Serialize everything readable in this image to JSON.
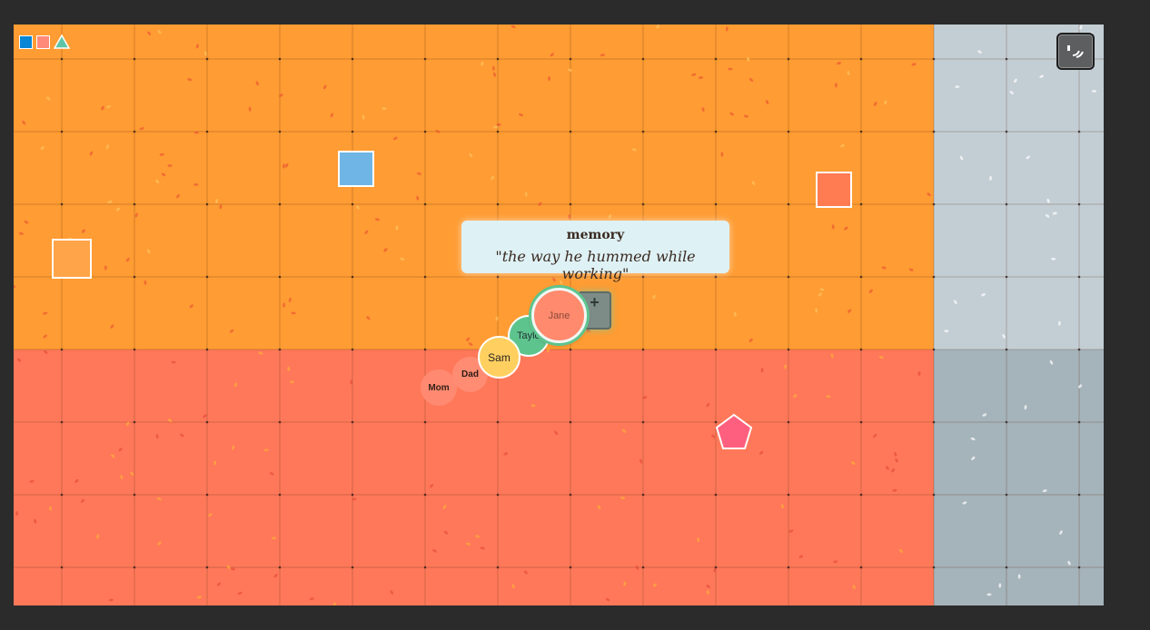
{
  "board": {
    "zones": [
      {
        "name": "orange-zone",
        "color": "#ff9c33"
      },
      {
        "name": "red-zone",
        "color": "#ff7859"
      },
      {
        "name": "gray-zone-top",
        "color": "#c3ced4"
      },
      {
        "name": "gray-zone-bottom",
        "color": "#a5b3ba"
      }
    ]
  },
  "legend": {
    "items": [
      {
        "shape": "square",
        "color": "#0a86d6"
      },
      {
        "shape": "square",
        "color": "#ff8a7a"
      },
      {
        "shape": "triangle",
        "color": "#5ec4a8"
      }
    ]
  },
  "pieces": [
    {
      "name": "blue-square",
      "color": "#6fb6e6"
    },
    {
      "name": "coral-square",
      "color": "#ff7b52"
    },
    {
      "name": "light-orange-square",
      "color": "#ffa448"
    },
    {
      "name": "pink-pentagon",
      "color": "#ff5f7e"
    }
  ],
  "memory_card": {
    "title": "memory",
    "quote": "\"the way he hummed while working\""
  },
  "tokens": {
    "mom": "Mom",
    "dad": "Dad",
    "sam": "Sam",
    "taylor": "Taylor",
    "jane": "Jane"
  },
  "add_button": {
    "icon": "plus-icon",
    "label": "+"
  },
  "corner_button": {
    "icon": "face-icon"
  }
}
